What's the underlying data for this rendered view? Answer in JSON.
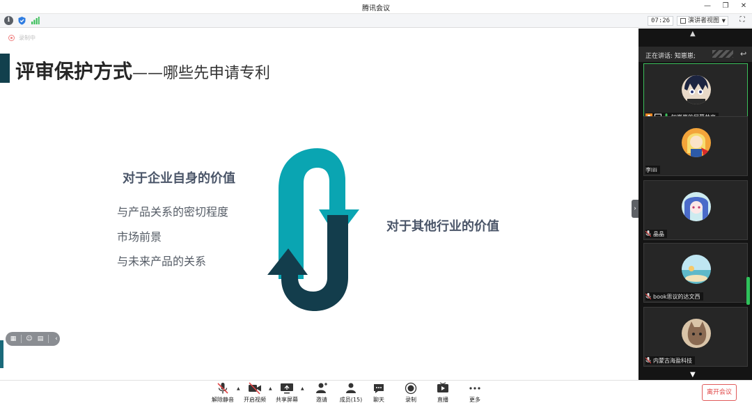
{
  "window": {
    "title": "腾讯会议"
  },
  "infobar": {
    "timer": "07:26",
    "view_label": "演讲者视图"
  },
  "slide": {
    "recording_badge": "录制中",
    "title_bold": "评审保护方式",
    "title_rest": "——哪些先申请专利",
    "left_heading": "对于企业自身的价值",
    "left_items": [
      "与产品关系的密切程度",
      "市场前景",
      "与未来产品的关系"
    ],
    "right_heading": "对于其他行业的价值",
    "arrow_colors": {
      "teal": "#0aa5b2",
      "navy": "#133d4c"
    }
  },
  "panel": {
    "speaking_label": "正在讲话: 知崽崽;",
    "participants": [
      {
        "name": "知崽崽的屏幕共享",
        "active": true,
        "avatar": "anime-boy-avatar"
      },
      {
        "name": "李lili",
        "active": false,
        "avatar": "supergirl-avatar"
      },
      {
        "name": "晶晶",
        "active": false,
        "avatar": "anime-girl-avatar"
      },
      {
        "name": "book思议的达文西",
        "active": false,
        "avatar": "beach-avatar"
      },
      {
        "name": "内蒙古海盈科技",
        "active": false,
        "avatar": "cat-avatar"
      }
    ]
  },
  "toolbar": {
    "mute": "解除静音",
    "video": "开启视频",
    "share": "共享屏幕",
    "invite": "邀请",
    "members": "成员(15)",
    "chat": "聊天",
    "record": "录制",
    "live": "直播",
    "more": "更多",
    "leave": "离开会议"
  }
}
